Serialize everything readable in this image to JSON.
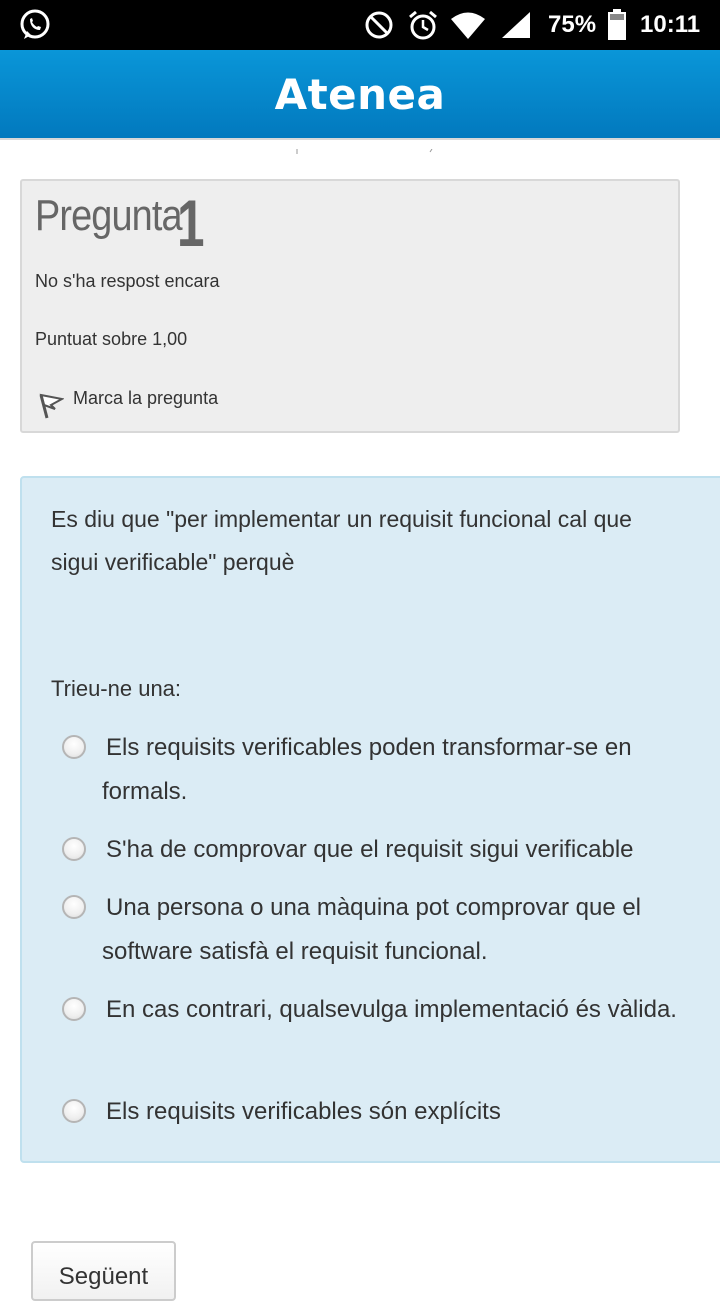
{
  "status_bar": {
    "battery_percent": "75%",
    "time": "10:11",
    "icons": [
      "whatsapp-icon",
      "do-not-disturb-icon",
      "alarm-icon",
      "wifi-icon",
      "signal-icon",
      "battery-icon"
    ]
  },
  "app": {
    "title": "Atenea"
  },
  "question_info": {
    "label": "Pregunta",
    "number": "1",
    "status": "No s'ha respost encara",
    "score": "Puntuat sobre 1,00",
    "flag_label": "Marca la pregunta"
  },
  "question": {
    "text": "Es diu que \"per implementar un requisit funcional cal que sigui verificable\" perquè",
    "prompt": "Trieu-ne una:",
    "options": [
      "Els requisits verificables poden transformar-se en formals.",
      "S'ha de comprovar que el requisit sigui verificable",
      "Una persona o una màquina pot comprovar que el software satisfà el requisit funcional.",
      "En cas contrari, qualsevulga implementació és vàlida.",
      "Els requisits verificables són explícits"
    ]
  },
  "navigation": {
    "next_label": "Següent"
  },
  "colors": {
    "appbar": "#0a8fd2",
    "question_bg": "#dbecf5",
    "info_bg": "#eeeeee"
  }
}
